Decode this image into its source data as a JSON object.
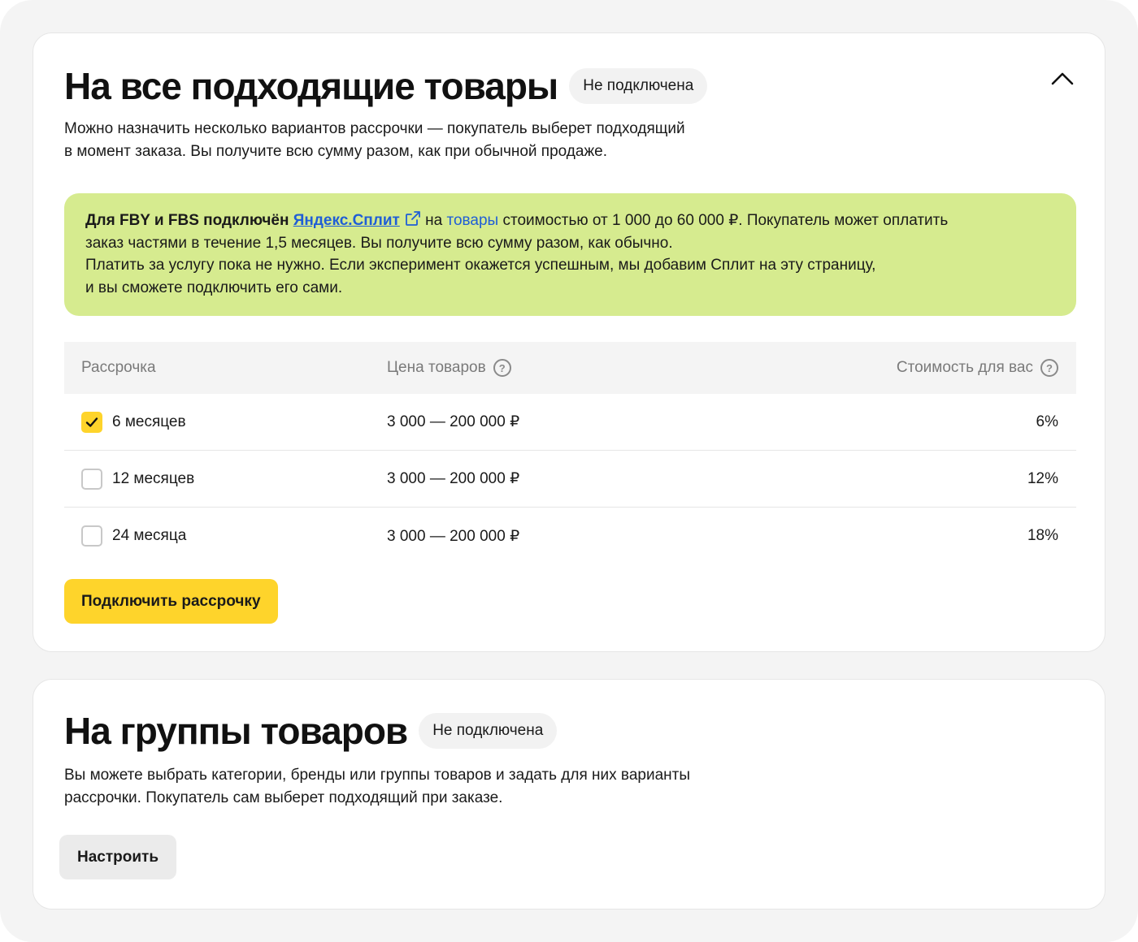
{
  "all_goods": {
    "title": "На все подходящие товары",
    "status": "Не подключена",
    "description_line1": "Можно назначить несколько вариантов рассрочки — покупатель выберет подходящий",
    "description_line2": "в момент заказа. Вы получите всю сумму разом, как при обычной продаже.",
    "notice": {
      "bold_prefix": "Для FBY и FBS подключён",
      "split_link": "Яндекс.Сплит",
      "on_text": "на",
      "goods_link": "товары",
      "line1_rest": "стоимостью от 1 000 до 60 000 ₽. Покупатель может оплатить",
      "line2": "заказ частями в течение 1,5 месяцев. Вы получите всю сумму разом, как обычно.",
      "line3": "Платить за услугу пока не нужно. Если эксперимент окажется успешным, мы добавим Сплит на эту страницу,",
      "line4": "и вы сможете подключить его сами."
    },
    "table": {
      "headers": [
        "Рассрочка",
        "Цена товаров",
        "Стоимость для вас"
      ],
      "rows": [
        {
          "term": "6 месяцев",
          "price": "3 000 — 200 000 ₽",
          "cost": "6%",
          "checked": true
        },
        {
          "term": "12 месяцев",
          "price": "3 000 — 200 000 ₽",
          "cost": "12%",
          "checked": false
        },
        {
          "term": "24 месяца",
          "price": "3 000 — 200 000 ₽",
          "cost": "18%",
          "checked": false
        }
      ]
    },
    "connect_button": "Подключить рассрочку"
  },
  "groups": {
    "title": "На группы товаров",
    "status": "Не подключена",
    "description_line1": "Вы можете выбрать категории, бренды или группы товаров и задать для них варианты",
    "description_line2": "рассрочки. Покупатель сам выберет подходящий при заказе.",
    "configure_button": "Настроить"
  },
  "icons": {
    "collapse": "chevron-up-icon",
    "external": "external-link-icon",
    "help": "question-circle-icon",
    "check": "checkmark-icon"
  },
  "colors": {
    "accent_yellow": "#fed42b",
    "notice_green": "#d6eb8f",
    "link_blue": "#1f5ed6",
    "page_bg": "#f4f4f4"
  }
}
